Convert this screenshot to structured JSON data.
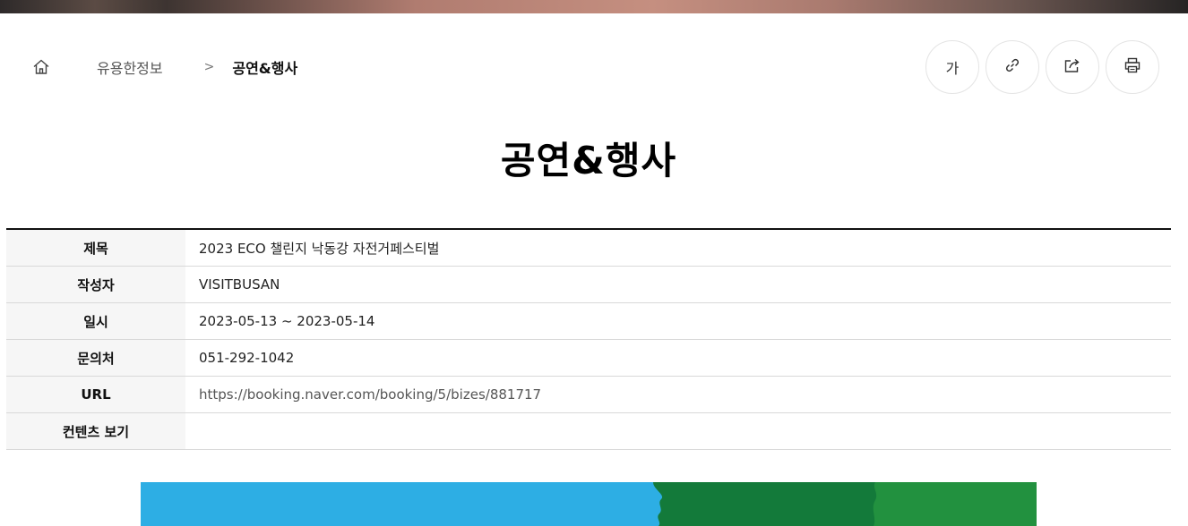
{
  "breadcrumb": {
    "home_icon": "home-icon",
    "level1": "유용한정보",
    "separator": ">",
    "current": "공연&행사"
  },
  "tools": {
    "font_size_label": "가",
    "link_icon": "link-icon",
    "share_icon": "share-icon",
    "print_icon": "print-icon"
  },
  "page_title": "공연&행사",
  "info_table": {
    "rows": [
      {
        "label": "제목",
        "value": "2023 ECO 챌린지 낙동강 자전거페스티벌"
      },
      {
        "label": "작성자",
        "value": "VISITBUSAN"
      },
      {
        "label": "일시",
        "value": "2023-05-13 ~ 2023-05-14"
      },
      {
        "label": "문의처",
        "value": "051-292-1042"
      },
      {
        "label": "URL",
        "value": "https://booking.naver.com/booking/5/bizes/881717"
      },
      {
        "label": "컨텐츠 보기",
        "value": ""
      }
    ]
  },
  "colors": {
    "poster_sky": "#2daee4",
    "poster_green_dark": "#137a3a",
    "poster_green_light": "#22913f"
  }
}
